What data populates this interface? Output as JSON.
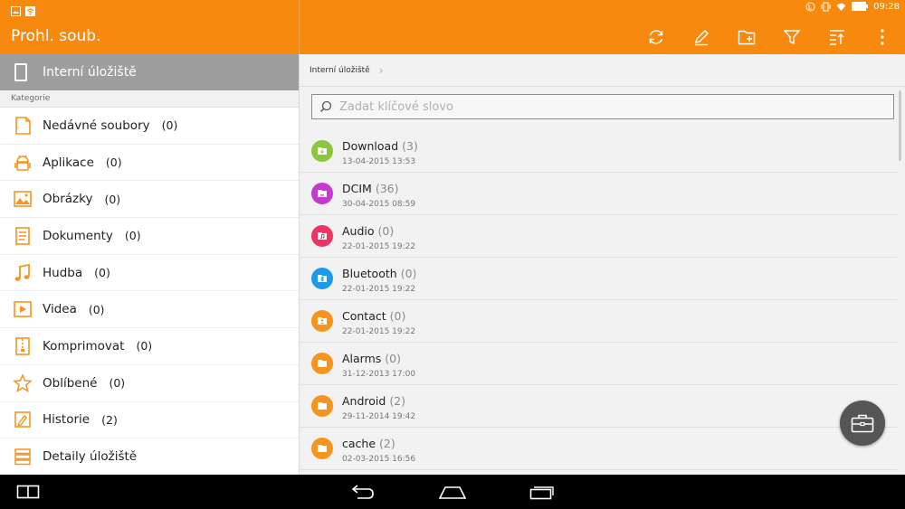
{
  "app": {
    "title": "Prohl. soub."
  },
  "status": {
    "time": "09:28"
  },
  "sidebar": {
    "storage_label": "Interní úložiště",
    "category_header": "Kategorie",
    "items": [
      {
        "label": "Nedávné soubory",
        "count": "(0)",
        "icon": "recent-files-icon"
      },
      {
        "label": "Aplikace",
        "count": "(0)",
        "icon": "android-icon"
      },
      {
        "label": "Obrázky",
        "count": "(0)",
        "icon": "image-icon"
      },
      {
        "label": "Dokumenty",
        "count": "(0)",
        "icon": "document-icon"
      },
      {
        "label": "Hudba",
        "count": "(0)",
        "icon": "music-icon"
      },
      {
        "label": "Videa",
        "count": "(0)",
        "icon": "video-icon"
      },
      {
        "label": "Komprimovat",
        "count": "(0)",
        "icon": "zip-icon"
      },
      {
        "label": "Oblíbené",
        "count": "(0)",
        "icon": "star-icon"
      },
      {
        "label": "Historie",
        "count": "(2)",
        "icon": "history-icon"
      },
      {
        "label": "Detaily úložiště",
        "count": "",
        "icon": "storage-details-icon"
      }
    ]
  },
  "main": {
    "breadcrumb": "Interní úložiště",
    "search_placeholder": "Zadat klíčové slovo",
    "files": [
      {
        "name": "Download",
        "count": "(3)",
        "date": "13-04-2015 13:53",
        "color": "#8cc63f"
      },
      {
        "name": "DCIM",
        "count": "(36)",
        "date": "30-04-2015 08:59",
        "color": "#c53ad1"
      },
      {
        "name": "Audio",
        "count": "(0)",
        "date": "22-01-2015 19:22",
        "color": "#ee3462"
      },
      {
        "name": "Bluetooth",
        "count": "(0)",
        "date": "22-01-2015 19:22",
        "color": "#1e9be8"
      },
      {
        "name": "Contact",
        "count": "(0)",
        "date": "22-01-2015 19:22",
        "color": "#f7941d"
      },
      {
        "name": "Alarms",
        "count": "(0)",
        "date": "31-12-2013 17:00",
        "color": "#f7941d"
      },
      {
        "name": "Android",
        "count": "(2)",
        "date": "29-11-2014 19:42",
        "color": "#f7941d"
      },
      {
        "name": "cache",
        "count": "(2)",
        "date": "02-03-2015 16:56",
        "color": "#f7941d"
      }
    ]
  },
  "colors": {
    "accent": "#f7890e",
    "selected": "#9e9e9e"
  }
}
